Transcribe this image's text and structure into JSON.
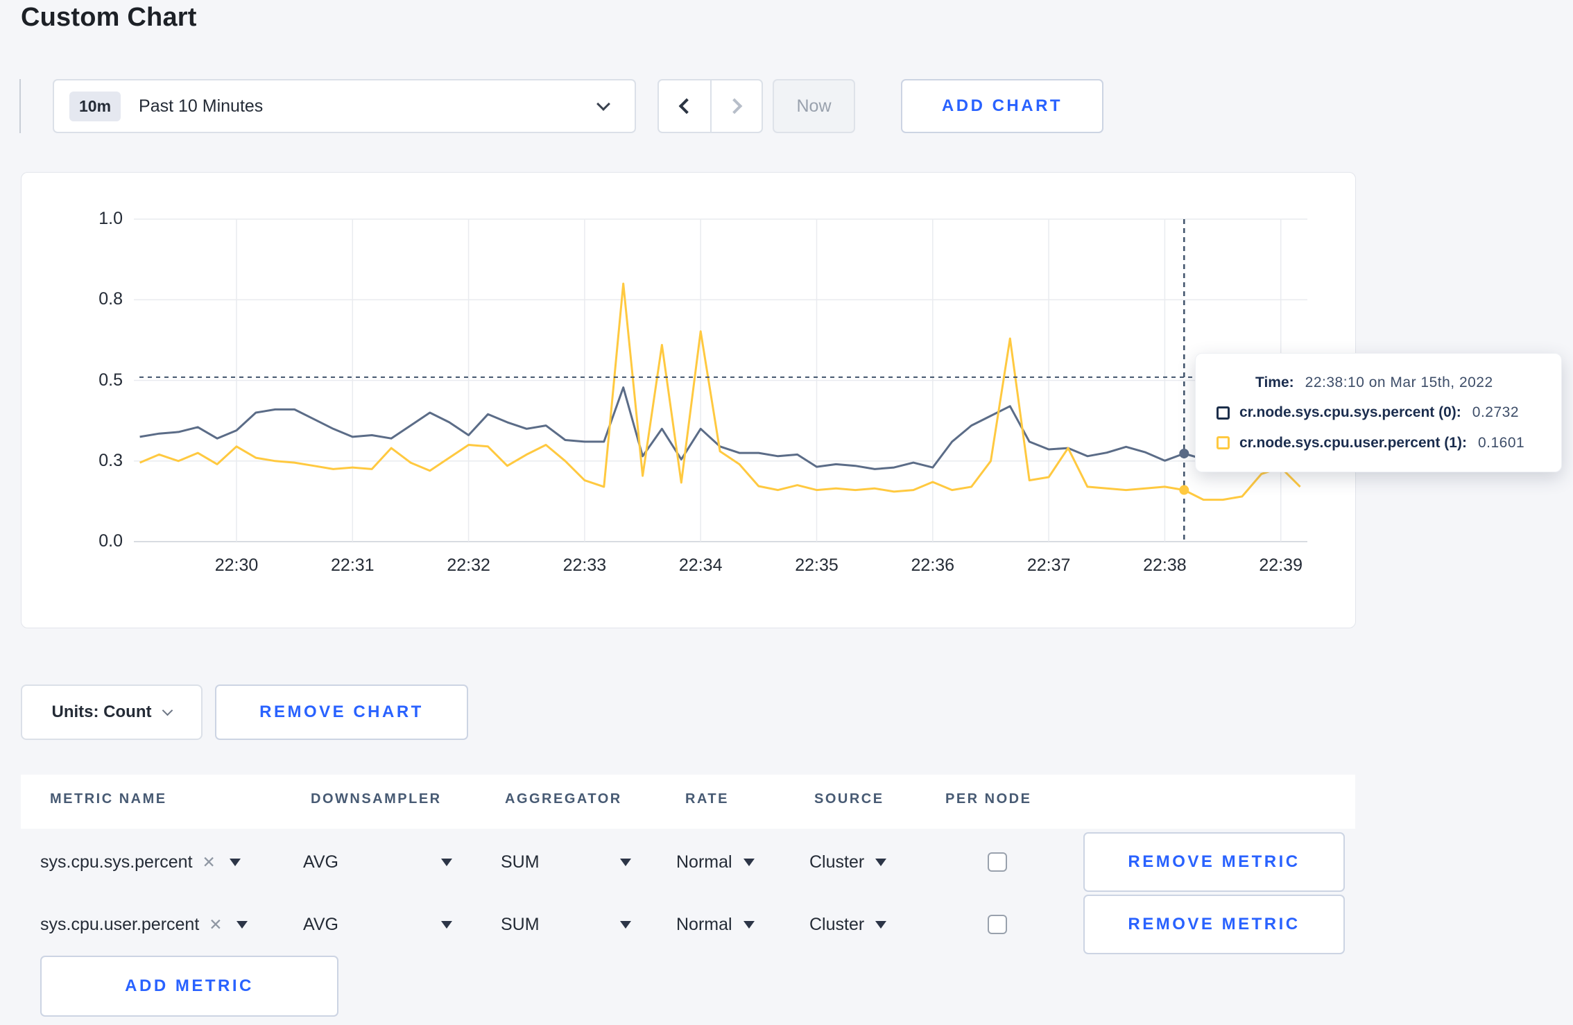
{
  "page": {
    "title": "Custom Chart"
  },
  "toolbar": {
    "time_badge": "10m",
    "time_label": "Past 10 Minutes",
    "now_label": "Now",
    "add_chart_label": "ADD CHART"
  },
  "chart_data": {
    "type": "line",
    "title": "",
    "xlabel": "",
    "ylabel": "",
    "ylim": [
      0,
      1
    ],
    "y_tick_values": [
      0,
      0.25,
      0.5,
      0.75,
      1
    ],
    "y_tick_labels": [
      "0.0",
      "0.3",
      "0.5",
      "0.8",
      "1.0"
    ],
    "x_tick_labels": [
      "22:30",
      "22:31",
      "22:32",
      "22:33",
      "22:34",
      "22:35",
      "22:36",
      "22:37",
      "22:38",
      "22:39"
    ],
    "x_start": "22:29:10",
    "x_step_seconds": 10,
    "grid": true,
    "series": [
      {
        "name": "cr.node.sys.cpu.sys.percent (0)",
        "color": "#5b6c87",
        "values": [
          0.325,
          0.335,
          0.34,
          0.355,
          0.32,
          0.345,
          0.4,
          0.41,
          0.41,
          0.38,
          0.35,
          0.325,
          0.33,
          0.32,
          0.36,
          0.4,
          0.37,
          0.33,
          0.395,
          0.37,
          0.35,
          0.36,
          0.315,
          0.31,
          0.31,
          0.478,
          0.265,
          0.35,
          0.255,
          0.35,
          0.295,
          0.275,
          0.275,
          0.265,
          0.27,
          0.232,
          0.24,
          0.235,
          0.225,
          0.23,
          0.245,
          0.23,
          0.31,
          0.36,
          0.39,
          0.42,
          0.31,
          0.286,
          0.29,
          0.265,
          0.276,
          0.294,
          0.277,
          0.251,
          0.2732,
          0.256,
          0.27,
          0.3,
          0.31,
          0.3,
          0.305
        ]
      },
      {
        "name": "cr.node.sys.cpu.user.percent (1)",
        "color": "#ffc940",
        "values": [
          0.245,
          0.27,
          0.25,
          0.275,
          0.24,
          0.295,
          0.26,
          0.25,
          0.245,
          0.235,
          0.225,
          0.23,
          0.225,
          0.29,
          0.245,
          0.22,
          0.26,
          0.3,
          0.295,
          0.235,
          0.27,
          0.3,
          0.25,
          0.19,
          0.17,
          0.8,
          0.204,
          0.61,
          0.183,
          0.652,
          0.28,
          0.24,
          0.172,
          0.16,
          0.175,
          0.16,
          0.165,
          0.16,
          0.165,
          0.155,
          0.16,
          0.185,
          0.16,
          0.17,
          0.25,
          0.63,
          0.19,
          0.2,
          0.29,
          0.17,
          0.165,
          0.16,
          0.165,
          0.17,
          0.1601,
          0.13,
          0.13,
          0.14,
          0.21,
          0.23,
          0.17
        ]
      }
    ],
    "crosshair": {
      "index": 54,
      "time": "22:38:10",
      "y_value": 0.51
    },
    "highlights": [
      {
        "series": 0,
        "index": 54,
        "value": 0.2732
      },
      {
        "series": 1,
        "index": 54,
        "value": 0.1601
      }
    ],
    "legend_position": "tooltip"
  },
  "tooltip": {
    "time_label": "Time:",
    "time_value": "22:38:10 on Mar 15th, 2022",
    "rows": [
      {
        "label": "cr.node.sys.cpu.sys.percent (0):",
        "value": "0.2732",
        "color": "#1c2e4a"
      },
      {
        "label": "cr.node.sys.cpu.user.percent (1):",
        "value": "0.1601",
        "color": "#ffc940"
      }
    ]
  },
  "chart_footer": {
    "units_label": "Units: Count",
    "remove_chart_label": "REMOVE CHART"
  },
  "metrics_table": {
    "headers": [
      "METRIC NAME",
      "DOWNSAMPLER",
      "AGGREGATOR",
      "RATE",
      "SOURCE",
      "PER NODE"
    ],
    "rows": [
      {
        "metric": "sys.cpu.sys.percent",
        "downsampler": "AVG",
        "aggregator": "SUM",
        "rate": "Normal",
        "source": "Cluster",
        "per_node_checked": false,
        "remove_label": "REMOVE METRIC"
      },
      {
        "metric": "sys.cpu.user.percent",
        "downsampler": "AVG",
        "aggregator": "SUM",
        "rate": "Normal",
        "source": "Cluster",
        "per_node_checked": false,
        "remove_label": "REMOVE METRIC"
      }
    ],
    "add_metric_label": "ADD METRIC"
  },
  "colors": {
    "accent_blue": "#2962ff",
    "grid": "#e9ebef",
    "crosshair": "#40536b"
  }
}
